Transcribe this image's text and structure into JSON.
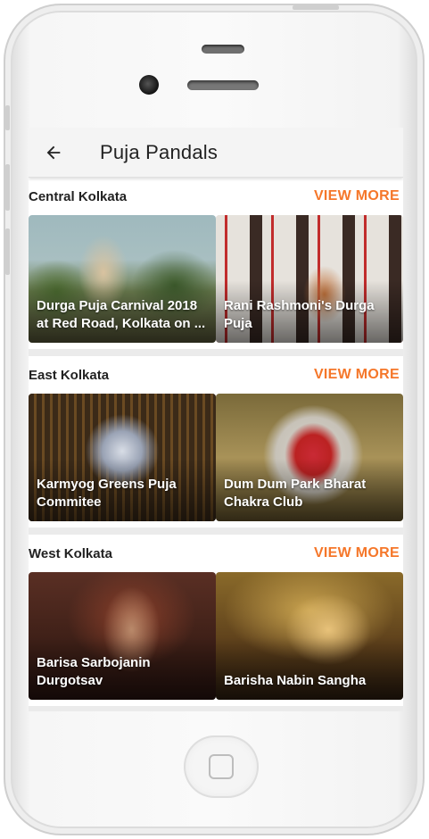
{
  "appbar": {
    "title": "Puja Pandals",
    "back_icon": "arrow-left-icon"
  },
  "sections": [
    {
      "title": "Central Kolkata",
      "view_more": "VIEW MORE",
      "cards": [
        {
          "caption": "Durga Puja Carnival 2018 at Red Road, Kolkata on ..."
        },
        {
          "caption": "Rani Rashmoni's Durga Puja"
        }
      ]
    },
    {
      "title": "East Kolkata",
      "view_more": "VIEW MORE",
      "cards": [
        {
          "caption": "Karmyog Greens Puja Commitee"
        },
        {
          "caption": "Dum Dum Park Bharat Chakra Club"
        }
      ]
    },
    {
      "title": "West Kolkata",
      "view_more": "VIEW MORE",
      "cards": [
        {
          "caption": "Barisa Sarbojanin Durgotsav"
        },
        {
          "caption": "Barisha Nabin Sangha"
        }
      ]
    }
  ],
  "colors": {
    "accent": "#f5772a",
    "appbar_bg": "#f4f4f4",
    "separator": "#ebebeb"
  }
}
